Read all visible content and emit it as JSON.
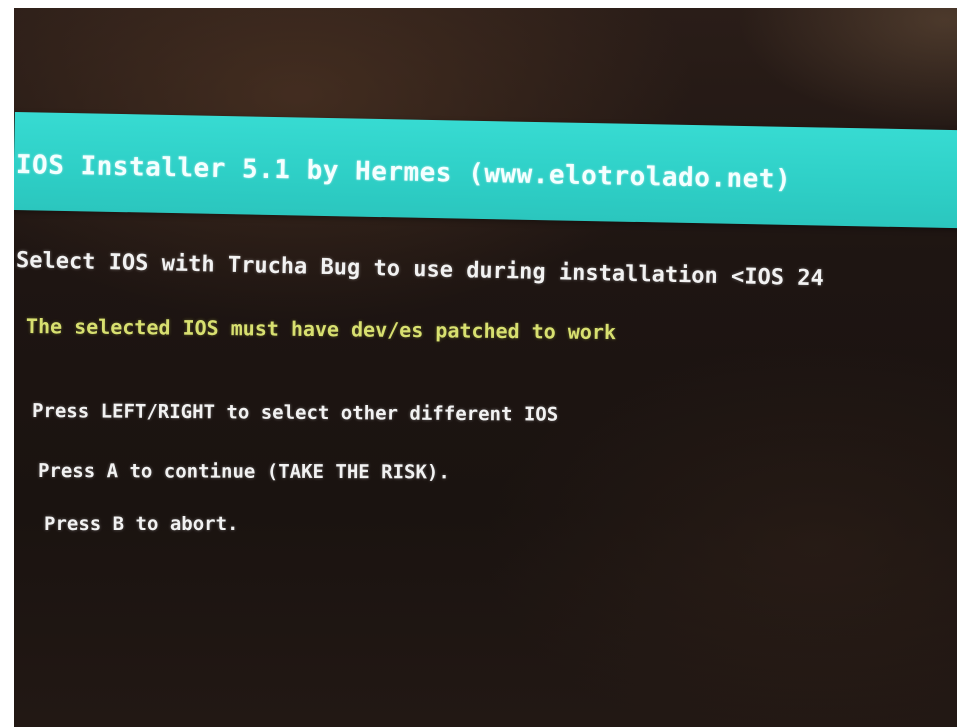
{
  "header": {
    "title": "IOS Installer 5.1 by Hermes (www.elotrolado.net)"
  },
  "main": {
    "select_prompt": "Select IOS with Trucha Bug to use during installation <IOS 24",
    "warning": "The selected IOS must have dev/es patched to work",
    "instructions": {
      "left_right": "Press LEFT/RIGHT to select other different IOS",
      "press_a": "Press A to continue (TAKE THE RISK).",
      "press_b": "Press B to abort."
    }
  },
  "colors": {
    "title_bar": "#2ecfc6",
    "background": "#1e1512",
    "text_white": "#f2f2f2",
    "text_yellow": "#d8e070"
  }
}
